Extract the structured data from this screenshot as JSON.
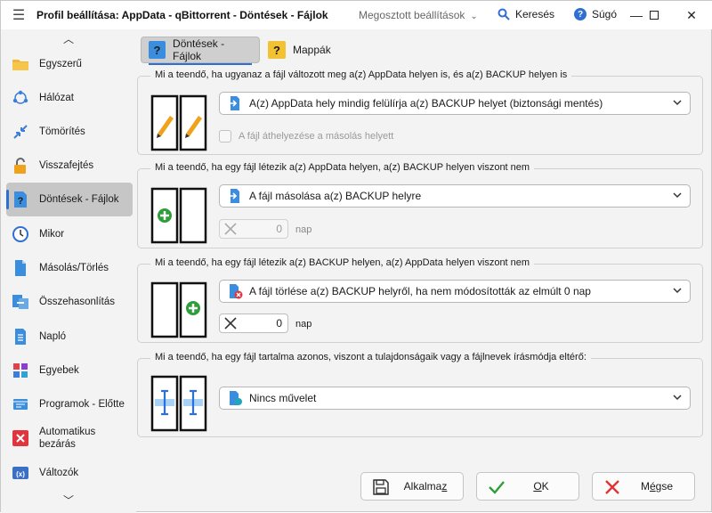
{
  "window": {
    "title": "Profil beállítása: AppData - qBittorrent - Döntések - Fájlok",
    "shared_settings": "Megosztott beállítások",
    "search_label": "Keresés",
    "help_label": "Súgó"
  },
  "sidebar": {
    "items": [
      {
        "label": "Egyszerű",
        "icon": "folder-icon"
      },
      {
        "label": "Hálózat",
        "icon": "network-icon"
      },
      {
        "label": "Tömörítés",
        "icon": "compress-icon"
      },
      {
        "label": "Visszafejtés",
        "icon": "unlock-icon"
      },
      {
        "label": "Döntések - Fájlok",
        "icon": "question-file-icon",
        "selected": true
      },
      {
        "label": "Mikor",
        "icon": "clock-icon"
      },
      {
        "label": "Másolás/Törlés",
        "icon": "copy-icon"
      },
      {
        "label": "Összehasonlítás",
        "icon": "compare-icon"
      },
      {
        "label": "Napló",
        "icon": "log-icon"
      },
      {
        "label": "Egyebek",
        "icon": "misc-icon"
      },
      {
        "label": "Programok - Előtte",
        "icon": "programs-icon"
      },
      {
        "label": "Automatikus bezárás",
        "icon": "close-red-icon"
      },
      {
        "label": "Változók",
        "icon": "variables-icon"
      }
    ]
  },
  "tabs": [
    {
      "label": "Döntések - Fájlok",
      "active": true
    },
    {
      "label": "Mappák",
      "active": false
    }
  ],
  "groups": {
    "changed": {
      "legend": "Mi a teendő, ha ugyanaz a fájl változott meg a(z) AppData helyen is, és a(z) BACKUP helyen is",
      "dropdown": "A(z) AppData hely mindig felülírja a(z) BACKUP helyet (biztonsági mentés)",
      "checkbox_label": "A fájl áthelyezése a másolás helyett"
    },
    "only_appdata": {
      "legend": "Mi a teendő, ha egy fájl létezik a(z) AppData helyen, a(z) BACKUP helyen viszont nem",
      "dropdown": "A fájl másolása a(z) BACKUP helyre",
      "spin_value": "0",
      "spin_unit": "nap"
    },
    "only_backup": {
      "legend": "Mi a teendő, ha egy fájl létezik a(z) BACKUP helyen, a(z) AppData helyen viszont nem",
      "dropdown": "A fájl törlése a(z) BACKUP helyről, ha nem módosították az elmúlt 0 nap",
      "spin_value": "0",
      "spin_unit": "nap"
    },
    "attributes": {
      "legend": "Mi a teendő, ha egy fájl tartalma azonos, viszont a tulajdonságaik vagy a fájlnevek írásmódja eltérő:",
      "dropdown": "Nincs művelet"
    }
  },
  "buttons": {
    "apply_prefix": "Alkalma",
    "apply_underlined": "z",
    "ok_underlined": "O",
    "ok_suffix": "K",
    "cancel_prefix": "M",
    "cancel_underlined": "é",
    "cancel_suffix": "gse"
  },
  "colors": {
    "accent": "#2f6ed3",
    "selected_bg": "#c6c6c6",
    "ok_check": "#2e9e3a",
    "cancel_x": "#e03535"
  }
}
